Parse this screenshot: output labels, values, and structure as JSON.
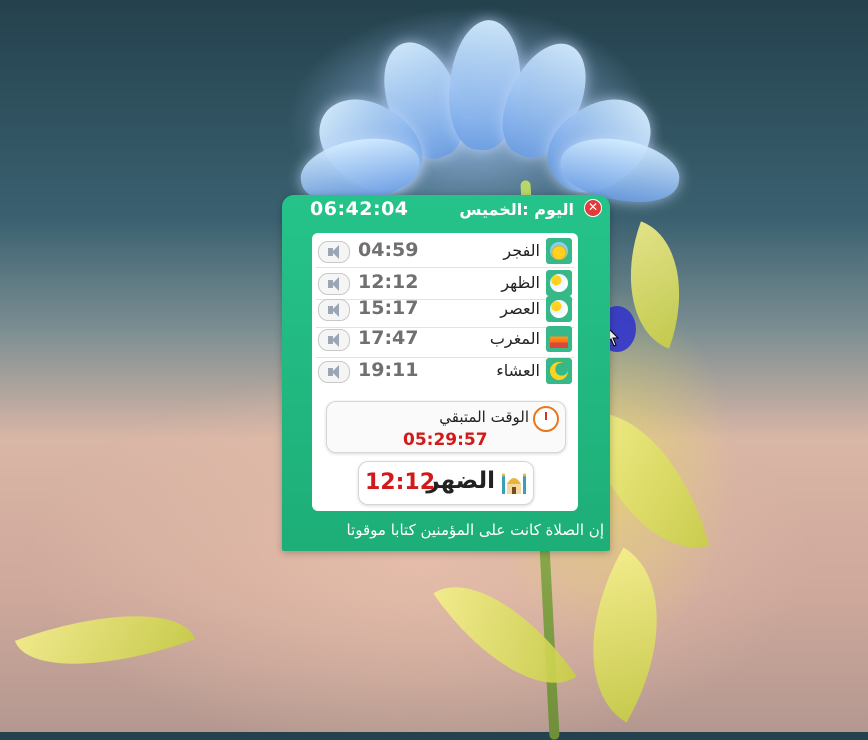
{
  "widget": {
    "current_time": "06:42:04",
    "day_label": "اليوم :الخميس",
    "close_label": "✕",
    "prayers": [
      {
        "name": "الفجر",
        "time": "04:59",
        "icon": "sunrise-icon"
      },
      {
        "name": "الظهر",
        "time": "12:12",
        "icon": "sun-cloud-icon"
      },
      {
        "name": "العصر",
        "time": "15:17",
        "icon": "sun-cloud-icon"
      },
      {
        "name": "المغرب",
        "time": "17:47",
        "icon": "sunset-icon"
      },
      {
        "name": "العشاء",
        "time": "19:11",
        "icon": "moon-icon"
      }
    ],
    "remaining_label": "الوقت المتبقي",
    "remaining_time": "05:29:57",
    "next_prayer_name": "الضهر",
    "next_prayer_time": "12:12",
    "verse": "إن الصلاة كانت على المؤمنين كتابا موقوتا"
  },
  "colors": {
    "widget_green": "#25c38a",
    "icon_bg": "#36b888",
    "countdown_red": "#d11a1a"
  }
}
